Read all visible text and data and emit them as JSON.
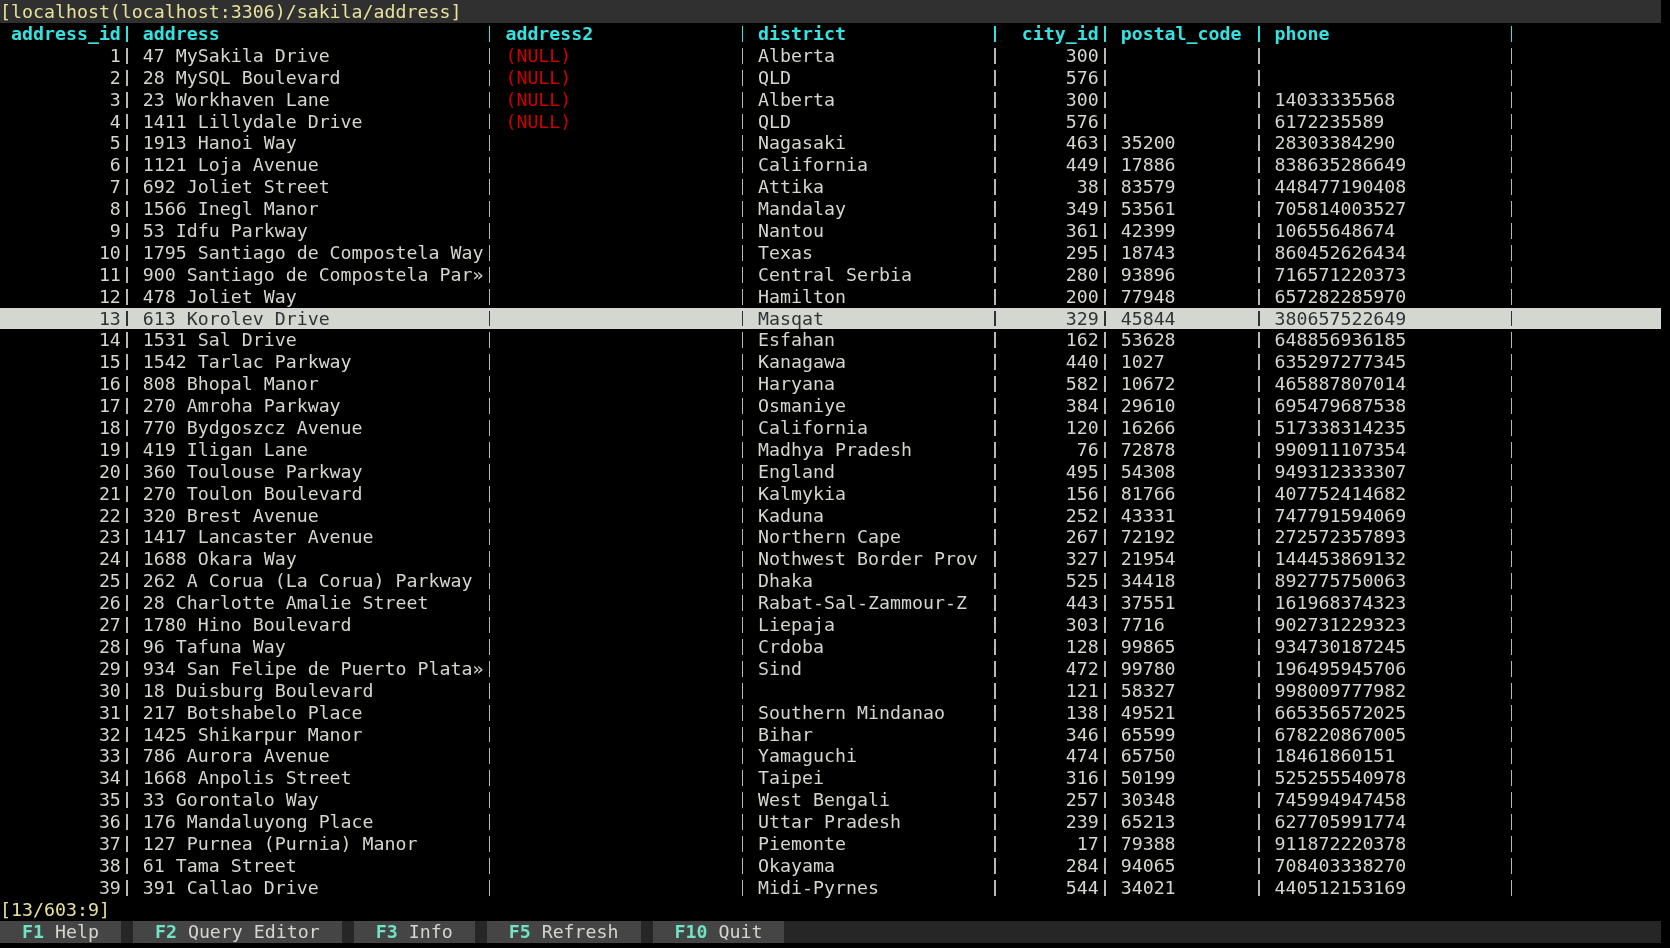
{
  "window": {
    "title": "[localhost(localhost:3306)/sakila/address]"
  },
  "table": {
    "columns": [
      "address_id",
      "address",
      "address2",
      "district",
      "city_id",
      "postal_code",
      "phone"
    ],
    "rows": [
      {
        "address_id": "1",
        "address": "47 MySakila Drive",
        "address2": "(NULL)",
        "address2_null": true,
        "district": "Alberta",
        "city_id": "300",
        "selected": false
      },
      {
        "address_id": "2",
        "address": "28 MySQL Boulevard",
        "address2": "(NULL)",
        "address2_null": true,
        "district": "QLD",
        "city_id": "576",
        "selected": false
      },
      {
        "address_id": "3",
        "address": "23 Workhaven Lane",
        "address2": "(NULL)",
        "address2_null": true,
        "district": "Alberta",
        "city_id": "300",
        "phone": "14033335568",
        "selected": false
      },
      {
        "address_id": "4",
        "address": "1411 Lillydale Drive",
        "address2": "(NULL)",
        "address2_null": true,
        "district": "QLD",
        "city_id": "576",
        "phone": "6172235589",
        "selected": false
      },
      {
        "address_id": "5",
        "address": "1913 Hanoi Way",
        "district": "Nagasaki",
        "city_id": "463",
        "postal_code": "35200",
        "phone": "28303384290",
        "selected": false
      },
      {
        "address_id": "6",
        "address": "1121 Loja Avenue",
        "district": "California",
        "city_id": "449",
        "postal_code": "17886",
        "phone": "838635286649",
        "selected": false
      },
      {
        "address_id": "7",
        "address": "692 Joliet Street",
        "district": "Attika",
        "city_id": "38",
        "postal_code": "83579",
        "phone": "448477190408",
        "selected": false
      },
      {
        "address_id": "8",
        "address": "1566 Inegl Manor",
        "district": "Mandalay",
        "city_id": "349",
        "postal_code": "53561",
        "phone": "705814003527",
        "selected": false
      },
      {
        "address_id": "9",
        "address": "53 Idfu Parkway",
        "district": "Nantou",
        "city_id": "361",
        "postal_code": "42399",
        "phone": "10655648674",
        "selected": false
      },
      {
        "address_id": "10",
        "address": "1795 Santiago de Compostela Way",
        "district": "Texas",
        "city_id": "295",
        "postal_code": "18743",
        "phone": "860452626434",
        "selected": false
      },
      {
        "address_id": "11",
        "address": "900 Santiago de Compostela Par»",
        "district": "Central Serbia",
        "city_id": "280",
        "postal_code": "93896",
        "phone": "716571220373",
        "selected": false
      },
      {
        "address_id": "12",
        "address": "478 Joliet Way",
        "district": "Hamilton",
        "city_id": "200",
        "postal_code": "77948",
        "phone": "657282285970",
        "selected": false
      },
      {
        "address_id": "13",
        "address": "613 Korolev Drive",
        "district": "Masqat",
        "city_id": "329",
        "postal_code": "45844",
        "phone": "380657522649",
        "selected": true
      },
      {
        "address_id": "14",
        "address": "1531 Sal Drive",
        "district": "Esfahan",
        "city_id": "162",
        "postal_code": "53628",
        "phone": "648856936185",
        "selected": false
      },
      {
        "address_id": "15",
        "address": "1542 Tarlac Parkway",
        "district": "Kanagawa",
        "city_id": "440",
        "postal_code": "1027",
        "phone": "635297277345",
        "selected": false
      },
      {
        "address_id": "16",
        "address": "808 Bhopal Manor",
        "district": "Haryana",
        "city_id": "582",
        "postal_code": "10672",
        "phone": "465887807014",
        "selected": false
      },
      {
        "address_id": "17",
        "address": "270 Amroha Parkway",
        "district": "Osmaniye",
        "city_id": "384",
        "postal_code": "29610",
        "phone": "695479687538",
        "selected": false
      },
      {
        "address_id": "18",
        "address": "770 Bydgoszcz Avenue",
        "district": "California",
        "city_id": "120",
        "postal_code": "16266",
        "phone": "517338314235",
        "selected": false
      },
      {
        "address_id": "19",
        "address": "419 Iligan Lane",
        "district": "Madhya Pradesh",
        "city_id": "76",
        "postal_code": "72878",
        "phone": "990911107354",
        "selected": false
      },
      {
        "address_id": "20",
        "address": "360 Toulouse Parkway",
        "district": "England",
        "city_id": "495",
        "postal_code": "54308",
        "phone": "949312333307",
        "selected": false
      },
      {
        "address_id": "21",
        "address": "270 Toulon Boulevard",
        "district": "Kalmykia",
        "city_id": "156",
        "postal_code": "81766",
        "phone": "407752414682",
        "selected": false
      },
      {
        "address_id": "22",
        "address": "320 Brest Avenue",
        "district": "Kaduna",
        "city_id": "252",
        "postal_code": "43331",
        "phone": "747791594069",
        "selected": false
      },
      {
        "address_id": "23",
        "address": "1417 Lancaster Avenue",
        "district": "Northern Cape",
        "city_id": "267",
        "postal_code": "72192",
        "phone": "272572357893",
        "selected": false
      },
      {
        "address_id": "24",
        "address": "1688 Okara Way",
        "district": "Nothwest Border Prov",
        "city_id": "327",
        "postal_code": "21954",
        "phone": "144453869132",
        "selected": false
      },
      {
        "address_id": "25",
        "address": "262 A Corua (La Corua) Parkway",
        "district": "Dhaka",
        "city_id": "525",
        "postal_code": "34418",
        "phone": "892775750063",
        "selected": false
      },
      {
        "address_id": "26",
        "address": "28 Charlotte Amalie Street",
        "district": "Rabat-Sal-Zammour-Z",
        "city_id": "443",
        "postal_code": "37551",
        "phone": "161968374323",
        "selected": false
      },
      {
        "address_id": "27",
        "address": "1780 Hino Boulevard",
        "district": "Liepaja",
        "city_id": "303",
        "postal_code": "7716",
        "phone": "902731229323",
        "selected": false
      },
      {
        "address_id": "28",
        "address": "96 Tafuna Way",
        "district": "Crdoba",
        "city_id": "128",
        "postal_code": "99865",
        "phone": "934730187245",
        "selected": false
      },
      {
        "address_id": "29",
        "address": "934 San Felipe de Puerto Plata»",
        "district": "Sind",
        "city_id": "472",
        "postal_code": "99780",
        "phone": "196495945706",
        "selected": false
      },
      {
        "address_id": "30",
        "address": "18 Duisburg Boulevard",
        "city_id": "121",
        "postal_code": "58327",
        "phone": "998009777982",
        "selected": false
      },
      {
        "address_id": "31",
        "address": "217 Botshabelo Place",
        "district": "Southern Mindanao",
        "city_id": "138",
        "postal_code": "49521",
        "phone": "665356572025",
        "selected": false
      },
      {
        "address_id": "32",
        "address": "1425 Shikarpur Manor",
        "district": "Bihar",
        "city_id": "346",
        "postal_code": "65599",
        "phone": "678220867005",
        "selected": false
      },
      {
        "address_id": "33",
        "address": "786 Aurora Avenue",
        "district": "Yamaguchi",
        "city_id": "474",
        "postal_code": "65750",
        "phone": "18461860151",
        "selected": false
      },
      {
        "address_id": "34",
        "address": "1668 Anpolis Street",
        "district": "Taipei",
        "city_id": "316",
        "postal_code": "50199",
        "phone": "525255540978",
        "selected": false
      },
      {
        "address_id": "35",
        "address": "33 Gorontalo Way",
        "district": "West Bengali",
        "city_id": "257",
        "postal_code": "30348",
        "phone": "745994947458",
        "selected": false
      },
      {
        "address_id": "36",
        "address": "176 Mandaluyong Place",
        "district": "Uttar Pradesh",
        "city_id": "239",
        "postal_code": "65213",
        "phone": "627705991774",
        "selected": false
      },
      {
        "address_id": "37",
        "address": "127 Purnea (Purnia) Manor",
        "district": "Piemonte",
        "city_id": "17",
        "postal_code": "79388",
        "phone": "911872220378",
        "selected": false
      },
      {
        "address_id": "38",
        "address": "61 Tama Street",
        "district": "Okayama",
        "city_id": "284",
        "postal_code": "94065",
        "phone": "708403338270",
        "selected": false
      },
      {
        "address_id": "39",
        "address": "391 Callao Drive",
        "district": "Midi-Pyrnes",
        "city_id": "544",
        "postal_code": "34021",
        "phone": "440512153169",
        "selected": false
      }
    ]
  },
  "status_bar": "[13/603:9]",
  "function_keys": [
    {
      "key": "F1",
      "label": "Help"
    },
    {
      "key": "F2",
      "label": "Query Editor"
    },
    {
      "key": "F3",
      "label": "Info"
    },
    {
      "key": "F5",
      "label": "Refresh"
    },
    {
      "key": "F10",
      "label": "Quit"
    }
  ]
}
